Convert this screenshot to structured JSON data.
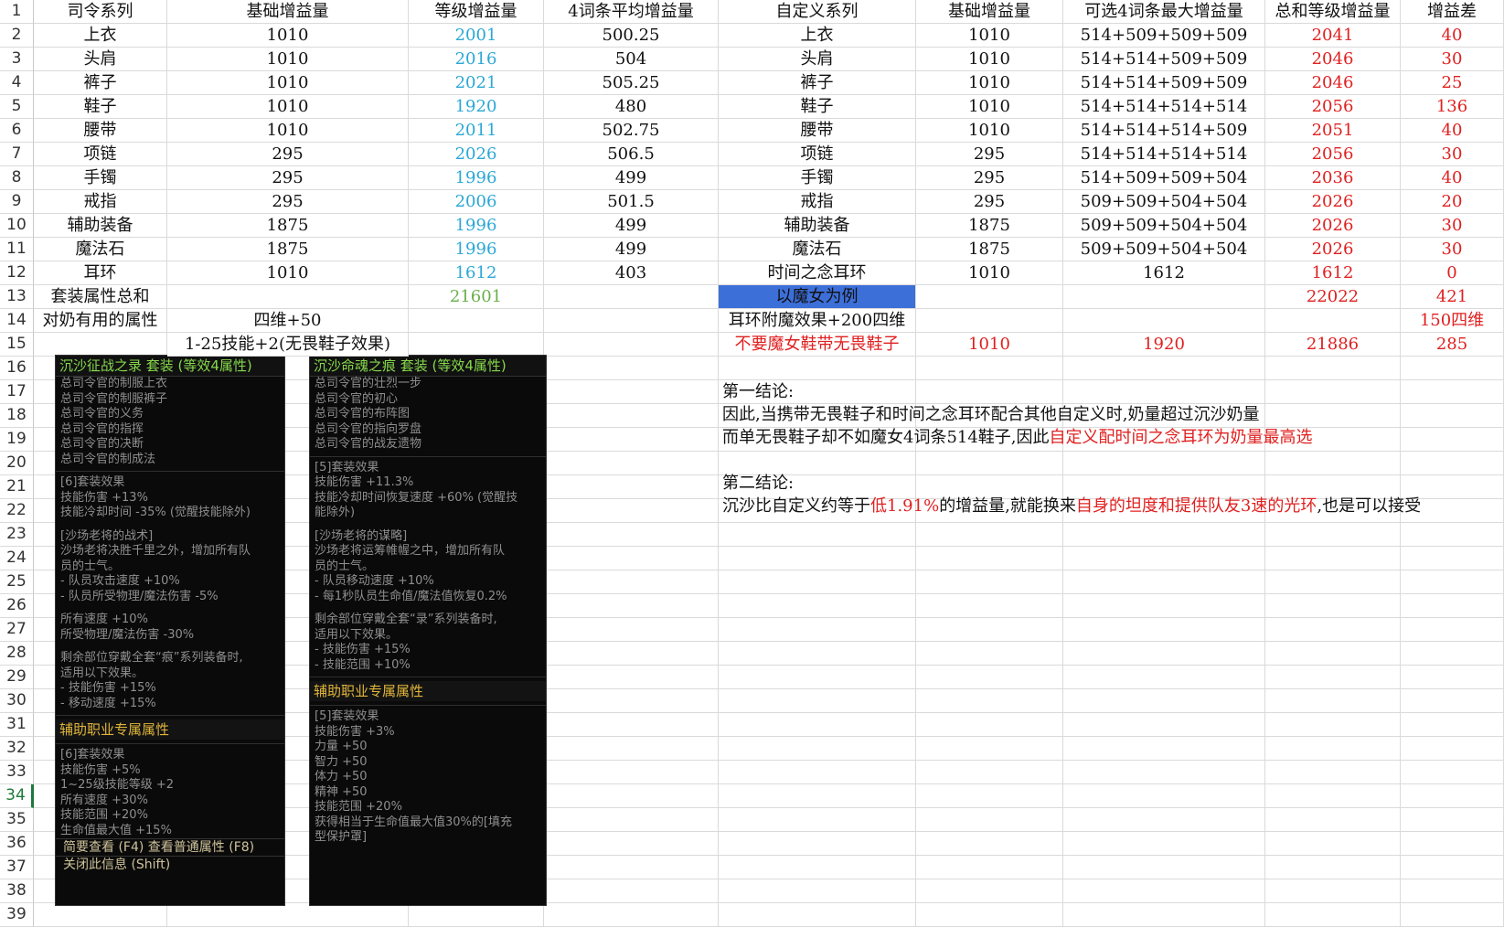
{
  "headers": [
    "司令系列",
    "基础增益量",
    "等级增益量",
    "4词条平均增益量",
    "自定义系列",
    "基础增益量",
    "可选4词条最大增益量",
    "总和等级增益量",
    "增益差"
  ],
  "rows": [
    [
      "上衣",
      "1010",
      "2001",
      "500.25",
      "上衣",
      "1010",
      "514+509+509+509",
      "2041",
      "40"
    ],
    [
      "头肩",
      "1010",
      "2016",
      "504",
      "头肩",
      "1010",
      "514+514+509+509",
      "2046",
      "30"
    ],
    [
      "裤子",
      "1010",
      "2021",
      "505.25",
      "裤子",
      "1010",
      "514+514+509+509",
      "2046",
      "25"
    ],
    [
      "鞋子",
      "1010",
      "1920",
      "480",
      "鞋子",
      "1010",
      "514+514+514+514",
      "2056",
      "136"
    ],
    [
      "腰带",
      "1010",
      "2011",
      "502.75",
      "腰带",
      "1010",
      "514+514+514+509",
      "2051",
      "40"
    ],
    [
      "项链",
      "295",
      "2026",
      "506.5",
      "项链",
      "295",
      "514+514+514+514",
      "2056",
      "30"
    ],
    [
      "手镯",
      "295",
      "1996",
      "499",
      "手镯",
      "295",
      "514+509+509+504",
      "2036",
      "40"
    ],
    [
      "戒指",
      "295",
      "2006",
      "501.5",
      "戒指",
      "295",
      "509+509+504+504",
      "2026",
      "20"
    ],
    [
      "辅助装备",
      "1875",
      "1996",
      "499",
      "辅助装备",
      "1875",
      "509+509+504+504",
      "2026",
      "30"
    ],
    [
      "魔法石",
      "1875",
      "1996",
      "499",
      "魔法石",
      "1875",
      "509+509+504+504",
      "2026",
      "30"
    ],
    [
      "耳环",
      "1010",
      "1612",
      "403",
      "时间之念耳环",
      "1010",
      "1612",
      "1612",
      "0"
    ]
  ],
  "row13": {
    "a": "套装属性总和",
    "c": "21601",
    "e": "以魔女为例",
    "h": "22022",
    "i": "421"
  },
  "row14": {
    "a": "对奶有用的属性",
    "b": "四维+50",
    "e": "耳环附魔效果+200四维",
    "i": "150四维"
  },
  "row15": {
    "b": "1-25技能+2(无畏鞋子效果)",
    "e": "不要魔女鞋带无畏鞋子",
    "f": "1010",
    "g": "1920",
    "h": "21886",
    "i": "285"
  },
  "notes": {
    "c1_title": "第一结论:",
    "c1_line1": "因此,当携带无畏鞋子和时间之念耳环配合其他自定义时,奶量超过沉沙奶量",
    "c1_line2a": "而单无畏鞋子却不如魔女4词条514鞋子,因此",
    "c1_line2b": "自定义配时间之念耳环为奶量最高选",
    "c2_title": "第二结论:",
    "c2_a": "沉沙比自定义约等于",
    "c2_b": "低1.91%",
    "c2_c": "的增益量,就能换来",
    "c2_d": "自身的坦度和提供队友3速的光环",
    "c2_e": ",也是可以接受"
  },
  "panel1": {
    "title": "沉沙征战之录  套装 (等效4属性)",
    "items": [
      "总司令官的制服上衣",
      "总司令官的制服裤子",
      "总司令官的义务",
      "总司令官的指挥",
      "总司令官的决断",
      "总司令官的制成法"
    ],
    "set6": [
      "[6]套装效果",
      "技能伤害 +13%",
      "技能冷却时间 -35% (觉醒技能除外)"
    ],
    "tactic": [
      "[沙场老将的战术]",
      "沙场老将决胜千里之外，增加所有队",
      "员的士气。",
      "- 队员攻击速度 +10%",
      "- 队员所受物理/魔法伤害 -5%"
    ],
    "speed": [
      "所有速度 +10%",
      "所受物理/魔法伤害 -30%"
    ],
    "rest": [
      "剩余部位穿戴全套“痕”系列装备时,",
      "适用以下效果。",
      "- 技能伤害 +15%",
      "- 移动速度 +15%"
    ],
    "support_title": "辅助职业专属属性",
    "support": [
      "[6]套装效果",
      "技能伤害 +5%",
      "1~25级技能等级 +2",
      "所有速度 +30%",
      "技能范围 +20%",
      "生命值最大值 +15%"
    ],
    "foot1": "简要查看 (F4) 查看普通属性 (F8)",
    "foot2": "关闭此信息 (Shift)"
  },
  "panel2": {
    "title": "沉沙命魂之痕  套装 (等效4属性)",
    "items": [
      "总司令官的壮烈一步",
      "总司令官的初心",
      "总司令官的布阵图",
      "总司令官的指向罗盘",
      "总司令官的战友遗物"
    ],
    "set5": [
      "[5]套装效果",
      "技能伤害 +11.3%",
      "技能冷却时间恢复速度 +60% (觉醒技",
      "能除外)"
    ],
    "plan": [
      "[沙场老将的谋略]",
      "沙场老将运筹帷幄之中，增加所有队",
      "员的士气。",
      "- 队员移动速度 +10%",
      "- 每1秒队员生命值/魔法值恢复0.2%"
    ],
    "rest": [
      "剩余部位穿戴全套“录”系列装备时,",
      "适用以下效果。",
      "- 技能伤害 +15%",
      "- 技能范围 +10%"
    ],
    "support_title": "辅助职业专属属性",
    "support": [
      "[5]套装效果",
      "技能伤害 +3%",
      "力量 +50",
      "智力 +50",
      "体力 +50",
      "精神 +50",
      "技能范围 +20%",
      "获得相当于生命值最大值30%的[填充",
      "型保护罩]"
    ]
  }
}
